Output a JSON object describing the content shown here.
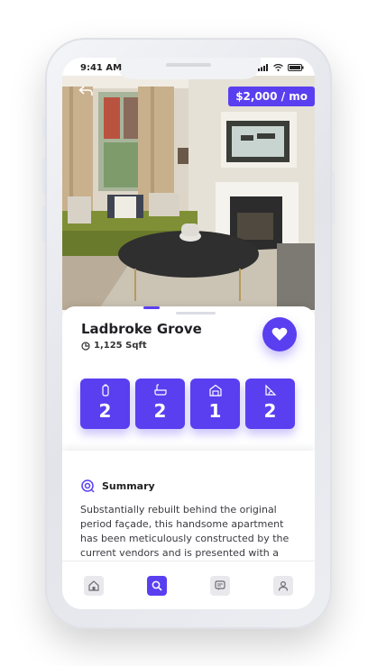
{
  "status": {
    "time": "9:41 AM"
  },
  "listing": {
    "price": "$2,000 / mo",
    "title": "Ladbroke Grove",
    "area": "1,125 Sqft"
  },
  "features": [
    {
      "icon": "bottle-icon",
      "value": "2"
    },
    {
      "icon": "bathtub-icon",
      "value": "2"
    },
    {
      "icon": "garage-icon",
      "value": "1"
    },
    {
      "icon": "plant-icon",
      "value": "2"
    }
  ],
  "summary": {
    "heading": "Summary",
    "text": "Substantially rebuilt behind the original period façade, this handsome apartment has been meticulously constructed by the current vendors and is presented with a wonderful"
  },
  "carousel": {
    "active_index": 0,
    "count": 4
  },
  "tabbar": {
    "items": [
      "home-icon",
      "search-icon",
      "chat-icon",
      "profile-icon"
    ],
    "active": "search-icon"
  },
  "colors": {
    "accent": "#5a3ff0"
  }
}
